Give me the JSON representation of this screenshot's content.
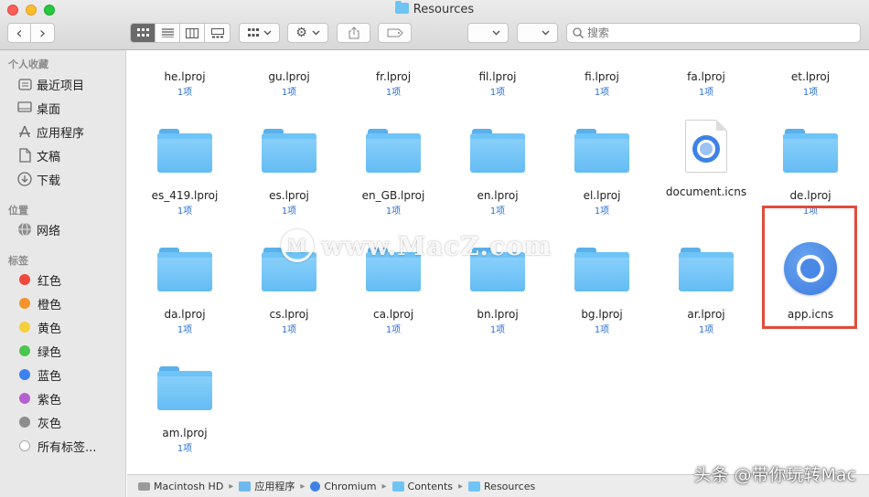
{
  "window": {
    "title": "Resources"
  },
  "toolbar": {
    "back_glyph": "‹",
    "forward_glyph": "›",
    "search_placeholder": "搜索"
  },
  "sidebar": {
    "favorites_header": "个人收藏",
    "favorites": [
      {
        "label": "最近项目",
        "icon": "clock-icon"
      },
      {
        "label": "桌面",
        "icon": "desktop-icon"
      },
      {
        "label": "应用程序",
        "icon": "applications-icon"
      },
      {
        "label": "文稿",
        "icon": "document-icon"
      },
      {
        "label": "下载",
        "icon": "download-icon"
      }
    ],
    "locations_header": "位置",
    "locations": [
      {
        "label": "网络",
        "icon": "network-icon"
      }
    ],
    "tags_header": "标签",
    "tags": [
      {
        "label": "红色",
        "color": "#f0483f"
      },
      {
        "label": "橙色",
        "color": "#f5932c"
      },
      {
        "label": "黄色",
        "color": "#f7cf3b"
      },
      {
        "label": "绿色",
        "color": "#4cc64e"
      },
      {
        "label": "蓝色",
        "color": "#3b82f0"
      },
      {
        "label": "紫色",
        "color": "#b55fd0"
      },
      {
        "label": "灰色",
        "color": "#8d8d8d"
      },
      {
        "label": "所有标签...",
        "color": "#ffffff"
      }
    ]
  },
  "files": [
    {
      "name": "he.lproj",
      "sub": "1项",
      "kind": "folder"
    },
    {
      "name": "gu.lproj",
      "sub": "1项",
      "kind": "folder"
    },
    {
      "name": "fr.lproj",
      "sub": "1项",
      "kind": "folder"
    },
    {
      "name": "fil.lproj",
      "sub": "1项",
      "kind": "folder"
    },
    {
      "name": "fi.lproj",
      "sub": "1项",
      "kind": "folder"
    },
    {
      "name": "fa.lproj",
      "sub": "1项",
      "kind": "folder"
    },
    {
      "name": "et.lproj",
      "sub": "1项",
      "kind": "folder"
    },
    {
      "name": "es_419.lproj",
      "sub": "1项",
      "kind": "folder"
    },
    {
      "name": "es.lproj",
      "sub": "1项",
      "kind": "folder"
    },
    {
      "name": "en_GB.lproj",
      "sub": "1项",
      "kind": "folder"
    },
    {
      "name": "en.lproj",
      "sub": "1项",
      "kind": "folder"
    },
    {
      "name": "el.lproj",
      "sub": "1项",
      "kind": "folder"
    },
    {
      "name": "document.icns",
      "sub": "",
      "kind": "doc"
    },
    {
      "name": "de.lproj",
      "sub": "1项",
      "kind": "folder"
    },
    {
      "name": "da.lproj",
      "sub": "1项",
      "kind": "folder"
    },
    {
      "name": "cs.lproj",
      "sub": "1项",
      "kind": "folder"
    },
    {
      "name": "ca.lproj",
      "sub": "1项",
      "kind": "folder"
    },
    {
      "name": "bn.lproj",
      "sub": "1项",
      "kind": "folder"
    },
    {
      "name": "bg.lproj",
      "sub": "1项",
      "kind": "folder"
    },
    {
      "name": "ar.lproj",
      "sub": "1项",
      "kind": "folder"
    },
    {
      "name": "app.icns",
      "sub": "",
      "kind": "app"
    },
    {
      "name": "am.lproj",
      "sub": "1项",
      "kind": "folder"
    }
  ],
  "pathbar": [
    {
      "label": "Macintosh HD",
      "icon": "hard-drive-icon",
      "color": "#9a9a9a"
    },
    {
      "label": "应用程序",
      "icon": "applications-folder-icon",
      "color": "#6fb8ee"
    },
    {
      "label": "Chromium",
      "icon": "chromium-icon",
      "color": "#3e82e6"
    },
    {
      "label": "Contents",
      "icon": "folder-icon",
      "color": "#6fc3f5"
    },
    {
      "label": "Resources",
      "icon": "folder-icon",
      "color": "#6fc3f5"
    }
  ],
  "watermark": {
    "text": "www.MacZ.com"
  },
  "corner_watermark": {
    "text": "头条 @带你玩转Mac"
  }
}
